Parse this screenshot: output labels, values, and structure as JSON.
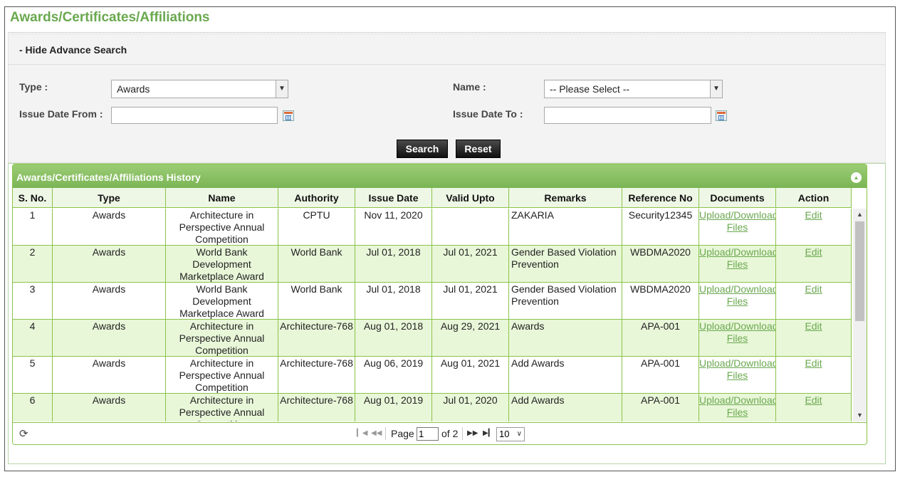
{
  "page": {
    "title": "Awards/Certificates/Affiliations"
  },
  "search": {
    "toggle_label": "- Hide Advance Search",
    "type_label": "Type :",
    "type_value": "Awards",
    "name_label": "Name :",
    "name_value": "-- Please Select --",
    "issue_from_label": "Issue Date From :",
    "issue_from_value": "",
    "issue_to_label": "Issue Date To :",
    "issue_to_value": "",
    "search_button": "Search",
    "reset_button": "Reset"
  },
  "grid": {
    "caption": "Awards/Certificates/Affiliations History",
    "columns": [
      "S. No.",
      "Type",
      "Name",
      "Authority",
      "Issue Date",
      "Valid Upto",
      "Remarks",
      "Reference No",
      "Documents",
      "Action"
    ],
    "rows": [
      {
        "sno": "1",
        "type": "Awards",
        "name": "Architecture in Perspective Annual Competition",
        "authority": "CPTU",
        "issue_date": "Nov 11, 2020",
        "valid_upto": "",
        "remarks": "ZAKARIA",
        "reference": "Security12345",
        "documents": "Upload/Download Files",
        "action": "Edit"
      },
      {
        "sno": "2",
        "type": "Awards",
        "name": "World Bank Development Marketplace Award",
        "authority": "World Bank",
        "issue_date": "Jul 01, 2018",
        "valid_upto": "Jul 01, 2021",
        "remarks": "Gender Based Violation Prevention",
        "reference": "WBDMA2020",
        "documents": "Upload/Download Files",
        "action": "Edit"
      },
      {
        "sno": "3",
        "type": "Awards",
        "name": "World Bank Development Marketplace Award",
        "authority": "World Bank",
        "issue_date": "Jul 01, 2018",
        "valid_upto": "Jul 01, 2021",
        "remarks": "Gender Based Violation Prevention",
        "reference": "WBDMA2020",
        "documents": "Upload/Download Files",
        "action": "Edit"
      },
      {
        "sno": "4",
        "type": "Awards",
        "name": "Architecture in Perspective Annual Competition",
        "authority": "Architecture-768",
        "issue_date": "Aug 01, 2018",
        "valid_upto": "Aug 29, 2021",
        "remarks": "Awards",
        "reference": "APA-001",
        "documents": "Upload/Download Files",
        "action": "Edit"
      },
      {
        "sno": "5",
        "type": "Awards",
        "name": "Architecture in Perspective Annual Competition",
        "authority": "Architecture-768",
        "issue_date": "Aug 06, 2019",
        "valid_upto": "Aug 01, 2021",
        "remarks": "Add Awards",
        "reference": "APA-001",
        "documents": "Upload/Download Files",
        "action": "Edit"
      },
      {
        "sno": "6",
        "type": "Awards",
        "name": "Architecture in Perspective Annual Competition",
        "authority": "Architecture-768",
        "issue_date": "Aug 01, 2019",
        "valid_upto": "Jul 01, 2020",
        "remarks": "Add Awards",
        "reference": "APA-001",
        "documents": "Upload/Download Files",
        "action": "Edit"
      }
    ]
  },
  "pager": {
    "page_label": "Page",
    "page_value": "1",
    "of_label": "of 2",
    "page_size": "10"
  },
  "icons": [
    "refresh-icon",
    "calendar-icon",
    "collapse-icon",
    "first-page-icon",
    "prev-page-icon",
    "next-page-icon",
    "last-page-icon"
  ],
  "colors": {
    "accent": "#6aa84f",
    "header_green": "#8bc34a",
    "alt_row": "#e9f7d9"
  }
}
